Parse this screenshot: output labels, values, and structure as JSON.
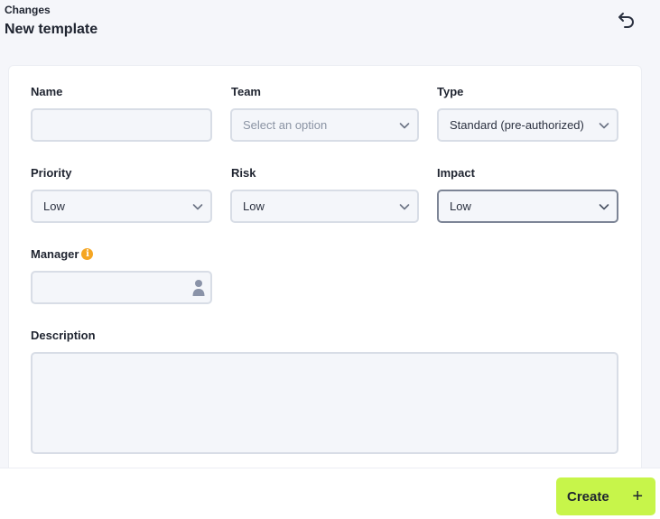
{
  "header": {
    "breadcrumb": "Changes",
    "title": "New template"
  },
  "form": {
    "name": {
      "label": "Name",
      "value": ""
    },
    "team": {
      "label": "Team",
      "placeholder": "Select an option"
    },
    "type": {
      "label": "Type",
      "value": "Standard (pre-authorized)"
    },
    "priority": {
      "label": "Priority",
      "value": "Low"
    },
    "risk": {
      "label": "Risk",
      "value": "Low"
    },
    "impact": {
      "label": "Impact",
      "value": "Low"
    },
    "manager": {
      "label": "Manager",
      "value": ""
    },
    "description": {
      "label": "Description",
      "value": ""
    }
  },
  "footer": {
    "create_label": "Create",
    "create_icon": "+"
  },
  "colors": {
    "accent": "#c7f54a",
    "info": "#f5a623",
    "field_bg": "#f4f6fa",
    "field_border": "#d8dde6"
  },
  "icons": [
    "undo-icon",
    "chevron-down-icon",
    "info-icon",
    "person-icon",
    "plus-icon"
  ]
}
